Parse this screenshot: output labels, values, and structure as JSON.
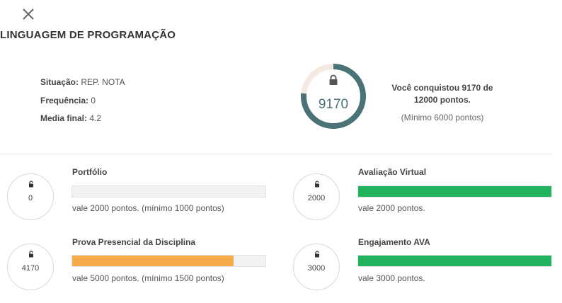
{
  "header": {
    "close_icon": "close-icon",
    "title": "LINGUAGEM DE PROGRAMAÇÃO"
  },
  "status": {
    "situacao_label": "Situação:",
    "situacao_value": "REP. NOTA",
    "frequencia_label": "Frequência:",
    "frequencia_value": "0",
    "media_label": "Media final:",
    "media_value": "4.2"
  },
  "score": {
    "points": "9170",
    "progress_fraction": 0.764,
    "lock_icon": "lock-icon",
    "summary_line1": "Você conquistou 9170 de",
    "summary_line2": "12000 pontos.",
    "minimum": "(Mínimo 6000 pontos)"
  },
  "items": [
    {
      "value": "0",
      "name": "Portfólio",
      "desc": "vale 2000 pontos. (mínimo 1000 pontos)",
      "progress": 0,
      "color": "#f2f2f2",
      "icon": "unlock-icon"
    },
    {
      "value": "2000",
      "name": "Avaliação Virtual",
      "desc": "vale 2000 pontos.",
      "progress": 1,
      "color": "#22b35e",
      "icon": "unlock-icon"
    },
    {
      "value": "4170",
      "name": "Prova Presencial da Disciplina",
      "desc": "vale 5000 pontos. (mínimo 1500 pontos)",
      "progress": 0.834,
      "color": "#f7ac4a",
      "icon": "unlock-icon"
    },
    {
      "value": "3000",
      "name": "Engajamento AVA",
      "desc": "vale 3000 pontos.",
      "progress": 1,
      "color": "#22b35e",
      "icon": "unlock-icon"
    }
  ],
  "colors": {
    "ring_progress": "#4a7377",
    "ring_track": "#f3e9e2",
    "green": "#22b35e",
    "orange": "#f7ac4a"
  }
}
